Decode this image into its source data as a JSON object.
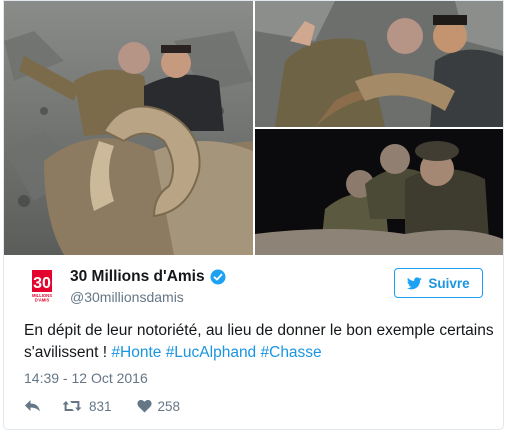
{
  "photos": [
    {
      "alt_icon": "hunting-photo-ram"
    },
    {
      "alt_icon": "hunting-photo-thumbs-up"
    },
    {
      "alt_icon": "hunting-photo-night"
    }
  ],
  "account": {
    "display_name": "30 Millions d'Amis",
    "handle": "@30millionsdamis",
    "verified": true,
    "avatar_logo_text": "30 MILLIONS D'AMIS FONDATION"
  },
  "follow_button": {
    "label": "Suivre"
  },
  "tweet": {
    "text": "En dépit de leur notoriété, au lieu de donner le bon exemple certains s'avilissent !",
    "hashtags": [
      "#Honte",
      "#LucAlphand",
      "#Chasse"
    ],
    "timestamp": "14:39 - 12 Oct 2016"
  },
  "actions": {
    "retweet_count": "831",
    "like_count": "258"
  },
  "colors": {
    "link": "#1b95e0",
    "secondary_text": "#657786",
    "avatar_red": "#e4032e"
  }
}
